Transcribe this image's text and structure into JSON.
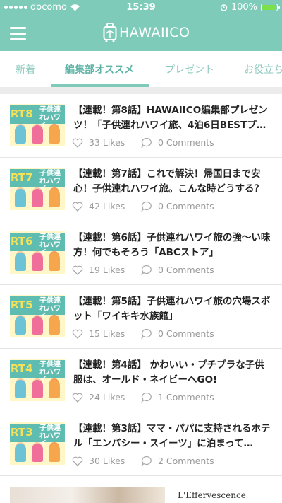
{
  "status_bar": {
    "carrier": "docomo",
    "time": "15:39",
    "battery": "100%",
    "battery_color": "#7be04a"
  },
  "header": {
    "menu_icon": "hamburger-menu-icon",
    "logo_text": "HAWAIICO",
    "logo_icon": "suitcase-icon",
    "accent_color": "#7ecbba"
  },
  "tabs": [
    {
      "label": "新着",
      "active": false
    },
    {
      "label": "編集部オススメ",
      "active": true
    },
    {
      "label": "プレゼント",
      "active": false
    },
    {
      "label": "お役立ち",
      "active": false
    }
  ],
  "articles": [
    {
      "part": "RT8",
      "title": "【連載！第8話】HAWAIICO編集部プレゼンツ！「子供連れハワイ旅、4泊6日BESTプ…",
      "likes": "33 Likes",
      "comments": "0 Comments"
    },
    {
      "part": "RT7",
      "title": "【連載！第7話】これで解決！帰国日まで安心！子供連れハワイ旅。こんな時どうする？",
      "likes": "42 Likes",
      "comments": "0 Comments"
    },
    {
      "part": "RT6",
      "title": "【連載！第6話】子供連れハワイ旅の強〜い味方！何でもそろう「ABCストア」",
      "likes": "19 Likes",
      "comments": "0 Comments"
    },
    {
      "part": "RT5",
      "title": "【連載！第5話】子供連れハワイ旅の穴場スポット「ワイキキ水族館」",
      "likes": "15 Likes",
      "comments": "0 Comments"
    },
    {
      "part": "RT4",
      "title": "【連載！第4話】 かわいい・プチプラな子供服は、オールド・ネイビーへGO!",
      "likes": "24 Likes",
      "comments": "1 Comments"
    },
    {
      "part": "RT3",
      "title": "【連載！第3話】ママ・パパに支持されるホテル「エンバシー・スイーツ」に泊まって…",
      "likes": "30 Likes",
      "comments": "2 Comments"
    }
  ],
  "thumb_caption": "子供連れハワイ",
  "ad": {
    "text": "L'Effervescence"
  }
}
